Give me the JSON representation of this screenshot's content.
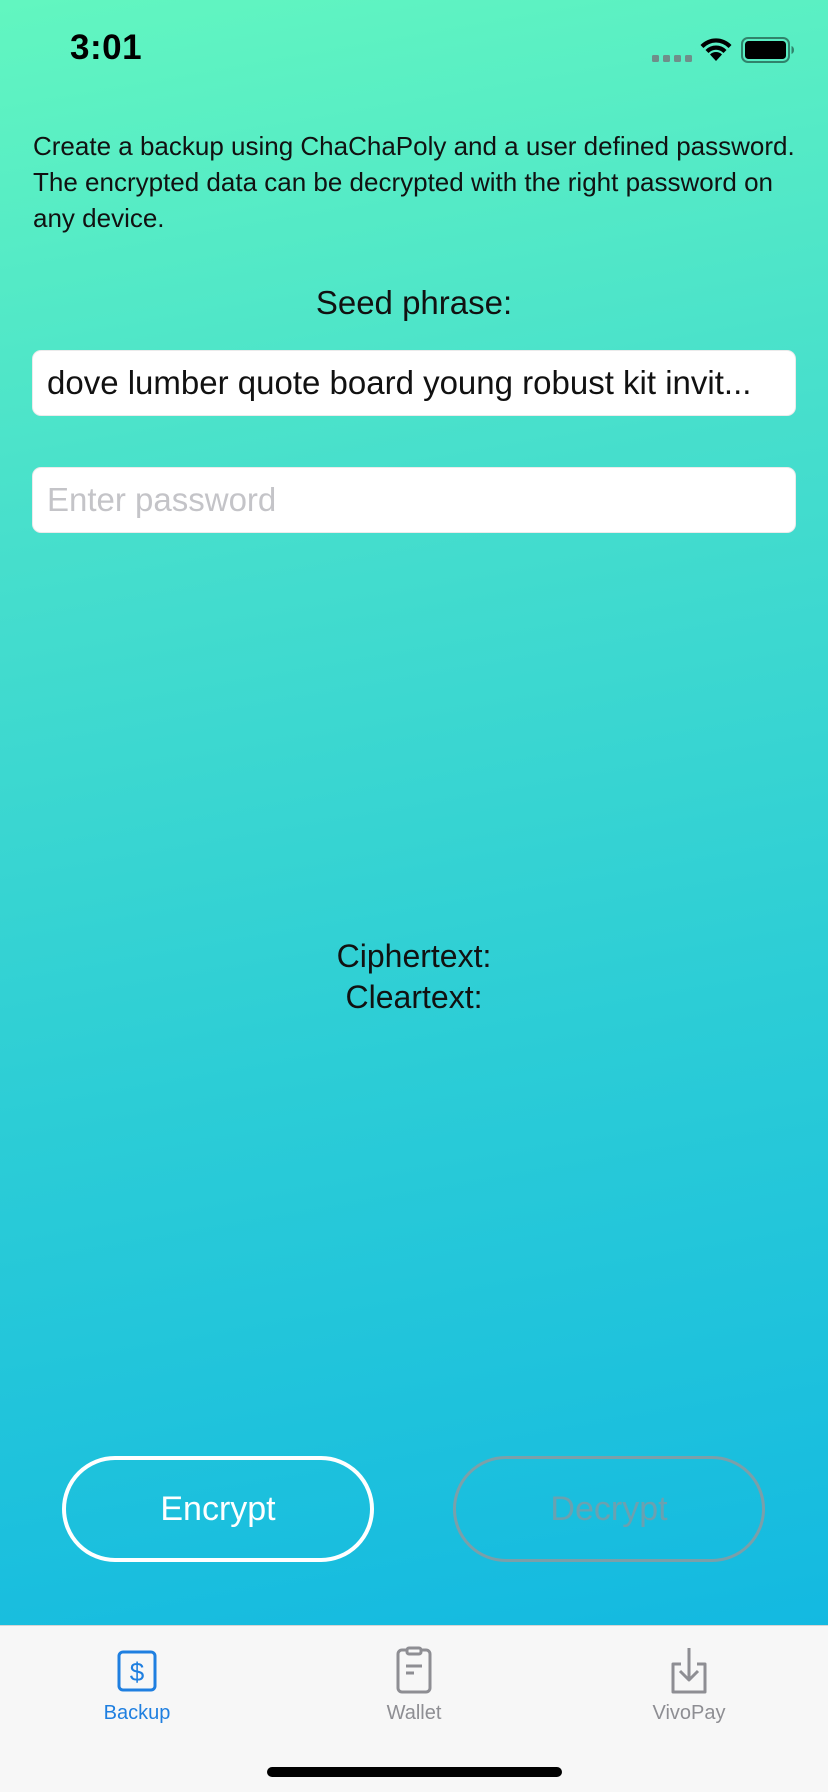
{
  "status_bar": {
    "time": "3:01"
  },
  "backup": {
    "description": "Create a backup using ChaChaPoly and a user defined password. The encrypted data can be decrypted with the right password on any device.",
    "seed_label": "Seed phrase:",
    "seed_value": "dove lumber quote board young robust kit invit...",
    "password_placeholder": "Enter password",
    "password_value": "",
    "ciphertext_label": "Ciphertext:",
    "cleartext_label": "Cleartext:",
    "encrypt_label": "Encrypt",
    "decrypt_label": "Decrypt"
  },
  "tab_bar": {
    "tabs": [
      {
        "label": "Backup",
        "icon": "dollar-icon",
        "active": true
      },
      {
        "label": "Wallet",
        "icon": "wallet-icon",
        "active": false
      },
      {
        "label": "VivoPay",
        "icon": "download-icon",
        "active": false
      }
    ]
  },
  "colors": {
    "gradient_top": "#62f6c0",
    "gradient_bottom": "#0db4e4",
    "tab_active": "#1f7fe0",
    "tab_inactive": "#8e8e93"
  }
}
